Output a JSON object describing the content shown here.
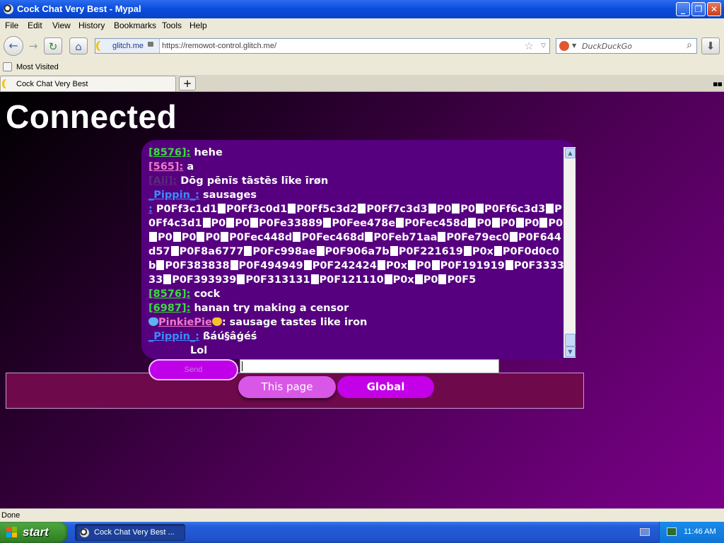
{
  "window": {
    "title": "Cock Chat Very Best - Mypal",
    "minimize": "_",
    "maximize": "❐",
    "close": "✕"
  },
  "menu": [
    "File",
    "Edit",
    "View",
    "History",
    "Bookmarks",
    "Tools",
    "Help"
  ],
  "nav": {
    "back_icon": "←",
    "forward_icon": "→",
    "reload_icon": "↻",
    "home_icon": "⌂",
    "site_identity": "glitch.me",
    "url": "https://remowot-control.glitch.me/",
    "star_icon": "☆",
    "dropdown_icon": "▽",
    "search_placeholder": "DuckDuckGo",
    "search_icon": "⌕",
    "download_icon": "⬇"
  },
  "bookmarks": {
    "most_visited": "Most Visited"
  },
  "tabs": [
    {
      "label": "Cock Chat Very Best"
    }
  ],
  "tabbar": {
    "new_tab": "+",
    "grid": "▪▪"
  },
  "page": {
    "status": "Connected",
    "send_label": "Send",
    "input_value": "",
    "scope_this": "This page",
    "scope_global": "Global"
  },
  "messages": [
    {
      "nick": "[8576]:",
      "text": " hehe"
    },
    {
      "nick": "[565]:",
      "text": " a"
    },
    {
      "nick": "[Ali]:",
      "text": " Dōg pēnīs tāstēs līke īrøn"
    },
    {
      "nick": "_Pippin_:",
      "text": " sausages"
    },
    {
      "nick": ":",
      "text": " P0Ff3c1d1",
      "segments": [
        "P0Ff3c0d1",
        "P0Ff5c3d2",
        "P0Ff7c3d3",
        "P0",
        "P0",
        "P0Ff6c3d3",
        "P0Ff4c3d1",
        "P0",
        "P0",
        "P0Fe33889",
        "P0Fee478e",
        "P0Fec458d",
        "P0",
        "P0",
        "P0",
        "P0",
        "P0",
        "P0",
        "P0",
        "P0Fec448d",
        "P0Fec468d",
        "P0Feb71aa",
        "P0Fe79ec0",
        "P0F644d57",
        "P0F8a6777",
        "P0Fc998ae",
        "P0F906a7b",
        "P0F221619",
        "P0x",
        "P0F0d0c0b",
        "P0F383838",
        "P0F494949",
        "P0F242424",
        "P0x",
        "P0",
        "P0F191919",
        "P0F333333",
        "P0F393939",
        "P0F313131",
        "P0F121110",
        "P0x",
        "P0",
        "P0F5"
      ]
    },
    {
      "nick": "[8576]:",
      "text": " cock"
    },
    {
      "nick": "[6987]:",
      "text": " hanan try making a censor"
    },
    {
      "nick": "PinkiePie",
      "text": ": sausage tastes like iron"
    },
    {
      "nick": "_Pippin_:",
      "text": " ßáú§âģéś"
    },
    {
      "nick": "",
      "text": "Lol"
    }
  ],
  "statusbar": {
    "text": "Done"
  },
  "taskbar": {
    "start": "start",
    "task_label": "Cock Chat Very Best ...",
    "clock": "11:46 AM"
  }
}
